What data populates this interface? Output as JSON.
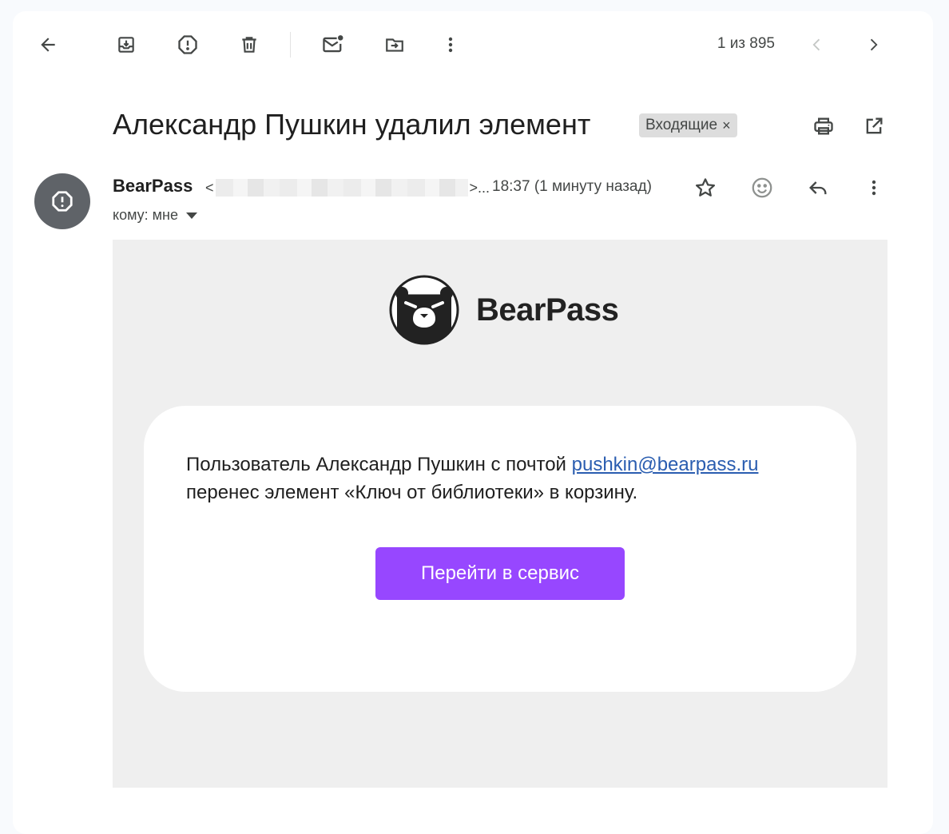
{
  "toolbar": {
    "back": "back-arrow-icon",
    "archive": "archive-icon",
    "spam": "report-spam-icon",
    "delete": "trash-icon",
    "mark_unread": "mark-unread-icon",
    "move": "move-to-icon",
    "more": "more-vert-icon",
    "counter": "1 из 895"
  },
  "email": {
    "subject": "Александр Пушкин удалил элемент",
    "label": "Входящие",
    "label_close": "×",
    "sender_name": "BearPass",
    "sender_email_prefix": "<",
    "sender_email_suffix": ">...",
    "time": "18:37 (1 минуту назад)",
    "recipient": "кому: мне"
  },
  "body": {
    "brand": "BearPass",
    "message_line1": "Пользователь Александр Пушкин с почтой ",
    "message_link": "pushkin@bearpass.ru",
    "message_line2": "перенес элемент «Ключ от библиотеки» в корзину.",
    "cta_label": "Перейти в сервис"
  },
  "colors": {
    "accent": "#9747ff",
    "link": "#2a5db0",
    "email_background": "#efefef",
    "avatar": "#5f6368"
  }
}
